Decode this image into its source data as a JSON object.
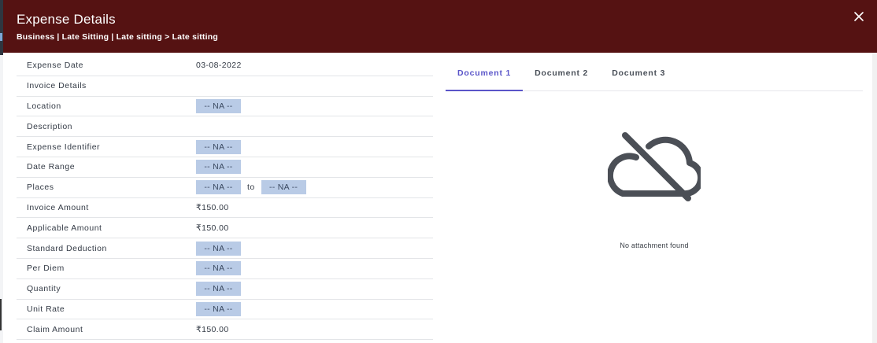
{
  "header": {
    "title": "Expense Details",
    "subtitle": "Business | Late Sitting | Late sitting > Late sitting"
  },
  "details": [
    {
      "label": "Expense Date",
      "type": "text",
      "value": "03-08-2022"
    },
    {
      "label": "Invoice Details",
      "type": "empty",
      "value": ""
    },
    {
      "label": "Location",
      "type": "chip",
      "value": "-- NA --"
    },
    {
      "label": "Description",
      "type": "empty",
      "value": ""
    },
    {
      "label": "Expense Identifier",
      "type": "chip",
      "value": "-- NA --"
    },
    {
      "label": "Date Range",
      "type": "chip",
      "value": "-- NA --"
    },
    {
      "label": "Places",
      "type": "range",
      "from": "-- NA --",
      "to_label": "to",
      "to": "-- NA --"
    },
    {
      "label": "Invoice Amount",
      "type": "text",
      "value": "₹150.00"
    },
    {
      "label": "Applicable Amount",
      "type": "text",
      "value": "₹150.00"
    },
    {
      "label": "Standard Deduction",
      "type": "chip",
      "value": "-- NA --"
    },
    {
      "label": "Per Diem",
      "type": "chip",
      "value": "-- NA --"
    },
    {
      "label": "Quantity",
      "type": "chip",
      "value": "-- NA --"
    },
    {
      "label": "Unit Rate",
      "type": "chip",
      "value": "-- NA --"
    },
    {
      "label": "Claim Amount",
      "type": "text",
      "value": "₹150.00"
    }
  ],
  "documents": {
    "tabs": [
      {
        "label": "Document 1",
        "active": true
      },
      {
        "label": "Document 2",
        "active": false
      },
      {
        "label": "Document 3",
        "active": false
      }
    ],
    "empty_icon": "cloud-off-icon",
    "empty_text": "No attachment found"
  },
  "colors": {
    "header_bg": "#551212",
    "accent": "#5a55c9",
    "chip_bg": "#b9cbe6"
  }
}
